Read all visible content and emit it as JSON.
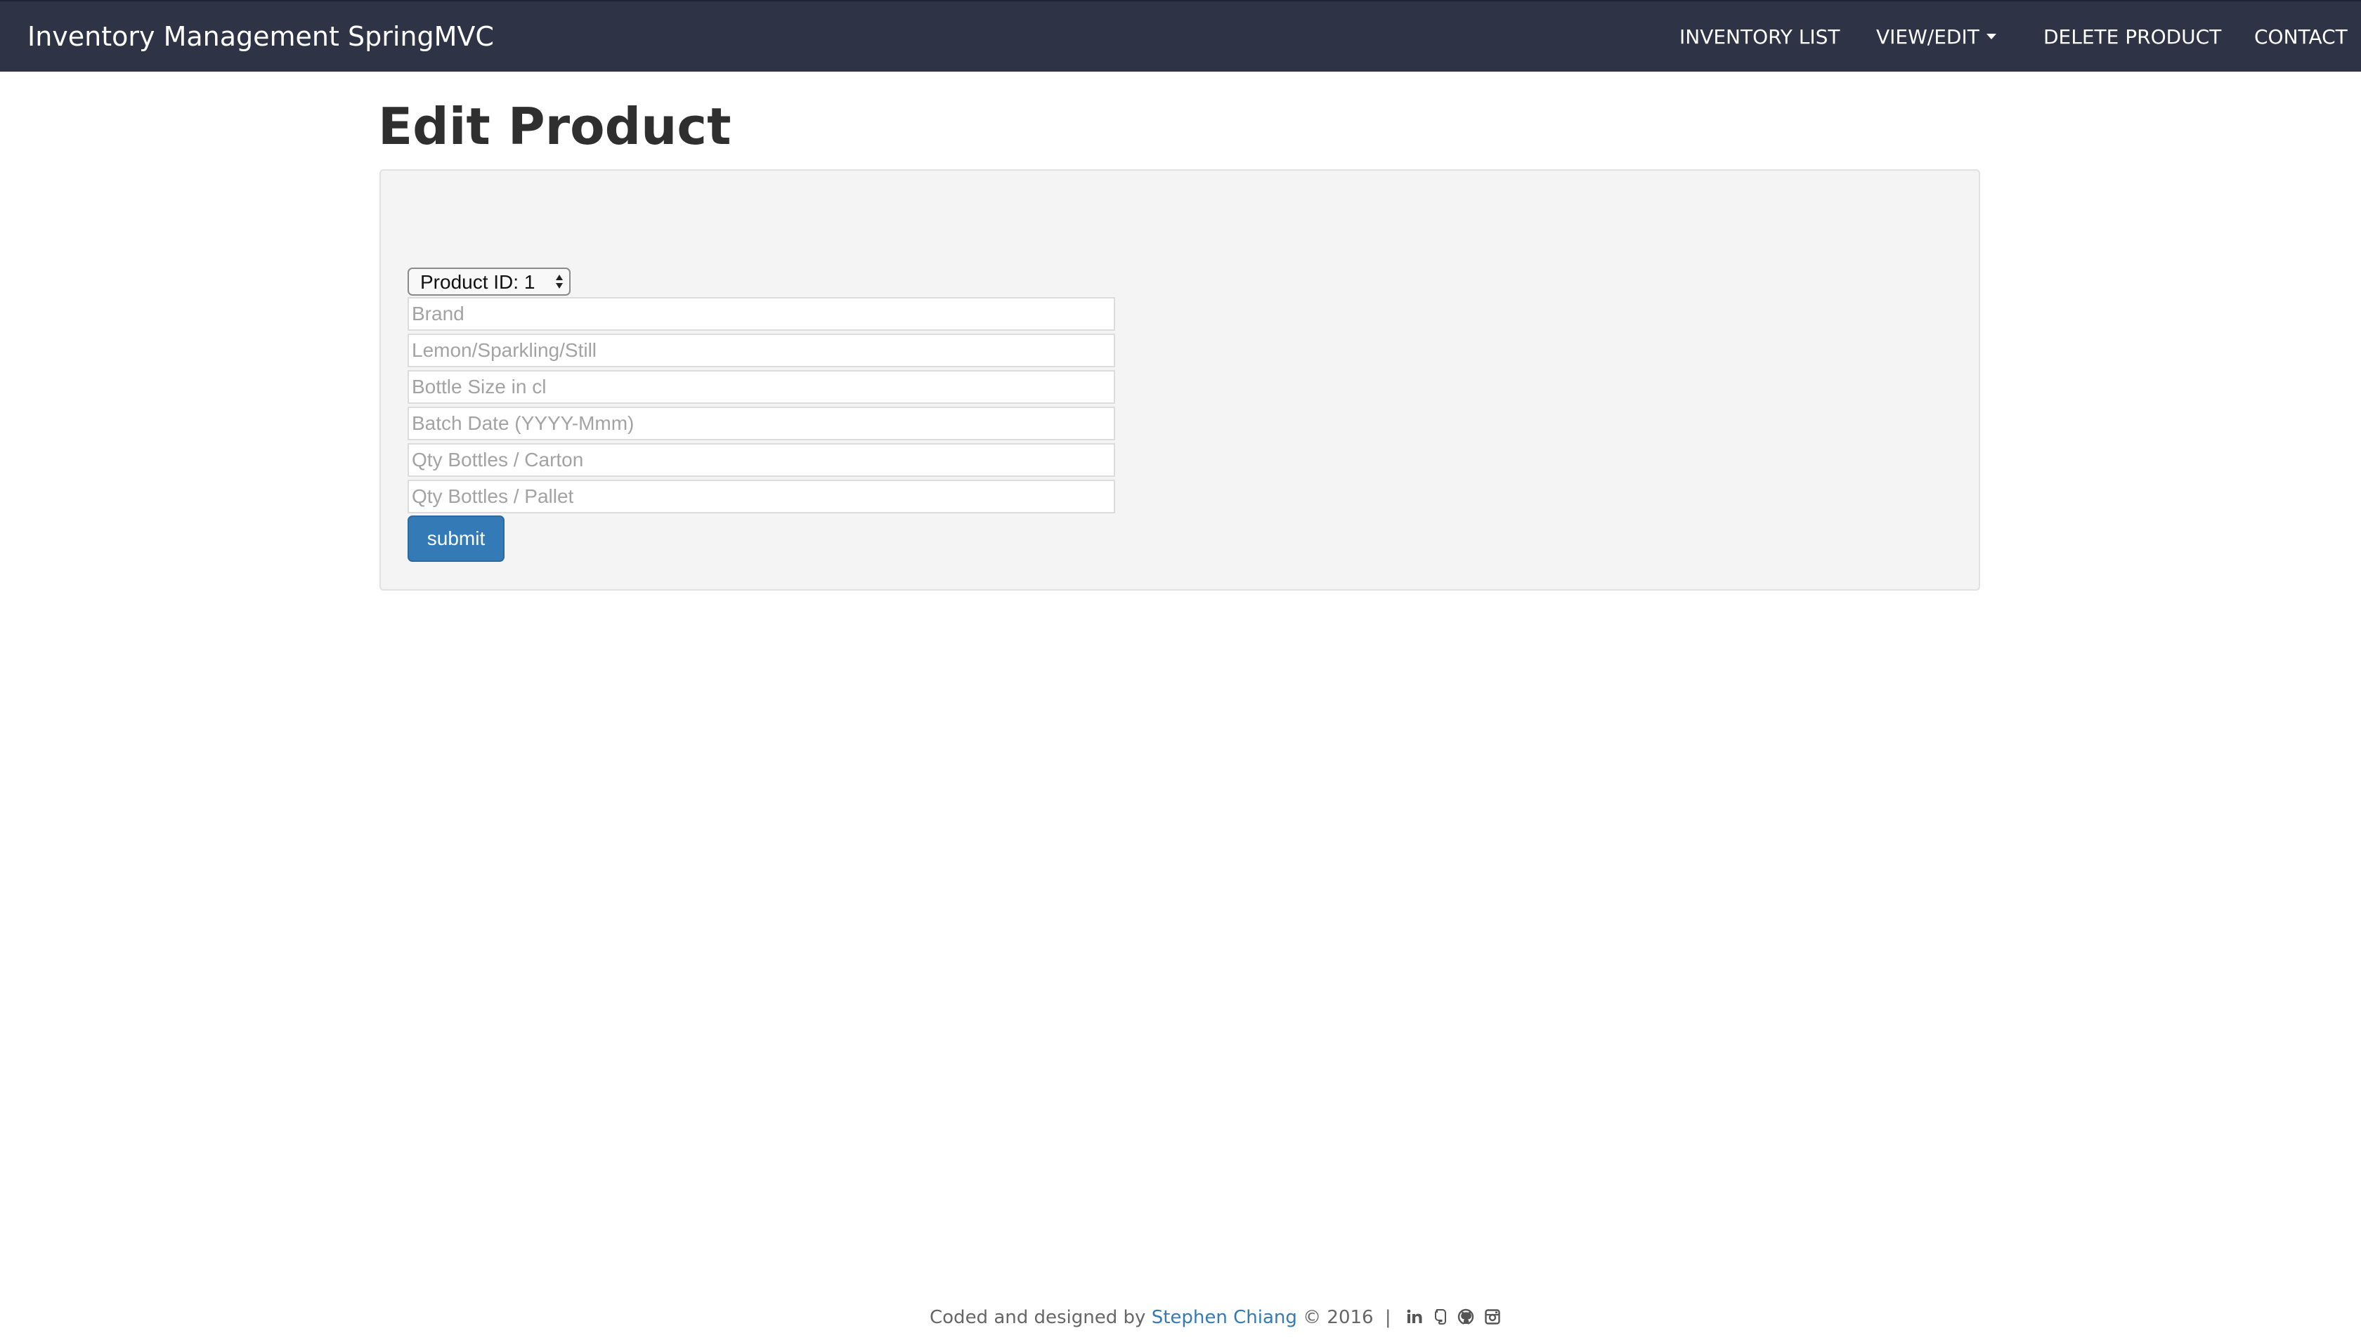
{
  "navbar": {
    "brand": "Inventory Management SpringMVC",
    "items": [
      {
        "label": "INVENTORY LIST"
      },
      {
        "label": "VIEW/EDIT"
      },
      {
        "label": "DELETE PRODUCT"
      },
      {
        "label": "CONTACT"
      }
    ]
  },
  "page": {
    "title": "Edit Product"
  },
  "form": {
    "product_select": {
      "selected": "Product ID: 1"
    },
    "fields": [
      {
        "placeholder": "Brand",
        "value": ""
      },
      {
        "placeholder": "Lemon/Sparkling/Still",
        "value": ""
      },
      {
        "placeholder": "Bottle Size in cl",
        "value": ""
      },
      {
        "placeholder": "Batch Date (YYYY-Mmm)",
        "value": ""
      },
      {
        "placeholder": "Qty Bottles / Carton",
        "value": ""
      },
      {
        "placeholder": "Qty Bottles / Pallet",
        "value": ""
      }
    ],
    "submit_label": "submit"
  },
  "footer": {
    "prefix": "Coded and designed by",
    "author": "Stephen Chiang",
    "copyright": "© 2016",
    "separator": "|",
    "social_icons": [
      "linkedin-icon",
      "evernote-icon",
      "github-icon",
      "instagram-icon"
    ]
  },
  "colors": {
    "navbar_bg": "#2e3445",
    "primary": "#337ab7",
    "panel_bg": "#f4f4f4"
  }
}
